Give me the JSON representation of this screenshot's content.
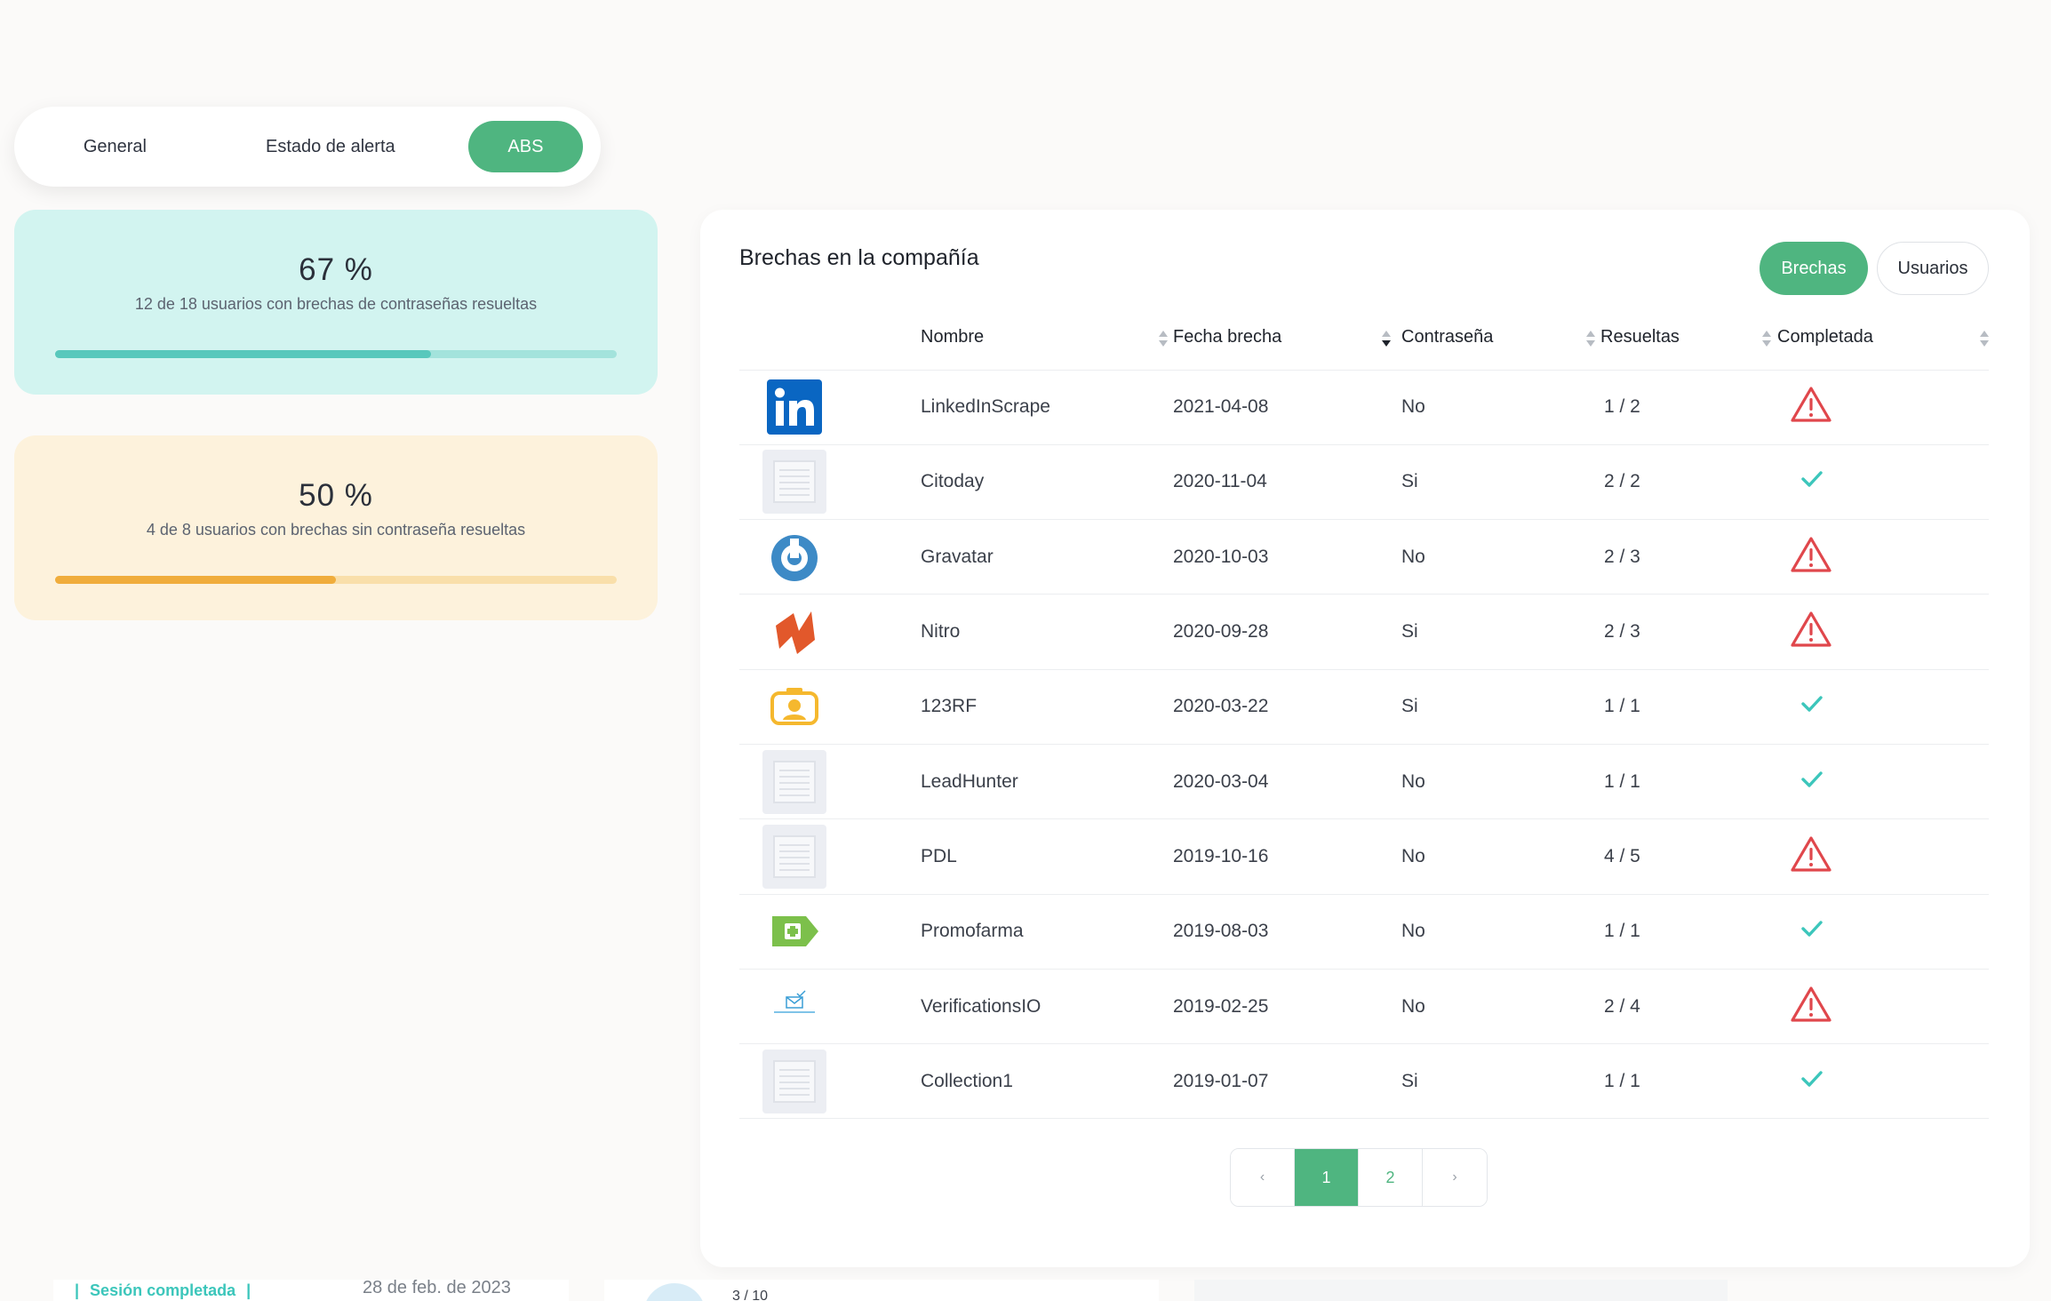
{
  "tabs": [
    {
      "label": "General",
      "active": false
    },
    {
      "label": "Estado de alerta",
      "active": false
    },
    {
      "label": "ABS",
      "active": true
    }
  ],
  "stats": [
    {
      "percent": "67 %",
      "description": "12 de 18 usuarios con brechas de contraseñas resueltas",
      "progress": 0.67,
      "color": "#58c8bc"
    },
    {
      "percent": "50 %",
      "description": "4 de 8 usuarios con brechas sin contraseña resueltas",
      "progress": 0.5,
      "color": "#f0ad3c"
    }
  ],
  "card": {
    "title": "Brechas en la compañía",
    "toggle": [
      {
        "label": "Brechas",
        "active": true
      },
      {
        "label": "Usuarios",
        "active": false
      }
    ]
  },
  "table": {
    "columns": [
      "Nombre",
      "Fecha brecha",
      "Contraseña",
      "Resueltas",
      "Completada"
    ],
    "rows": [
      {
        "logo": "linkedin-logo",
        "name": "LinkedInScrape",
        "date": "2021-04-08",
        "password": "No",
        "resolved": "1 / 2",
        "status": "warning"
      },
      {
        "logo": "placeholder",
        "name": "Citoday",
        "date": "2020-11-04",
        "password": "Si",
        "resolved": "2 / 2",
        "status": "check"
      },
      {
        "logo": "gravatar-logo",
        "name": "Gravatar",
        "date": "2020-10-03",
        "password": "No",
        "resolved": "2 / 3",
        "status": "warning"
      },
      {
        "logo": "nitro-logo",
        "name": "Nitro",
        "date": "2020-09-28",
        "password": "Si",
        "resolved": "2 / 3",
        "status": "warning"
      },
      {
        "logo": "123rf-logo",
        "name": "123RF",
        "date": "2020-03-22",
        "password": "Si",
        "resolved": "1 / 1",
        "status": "check"
      },
      {
        "logo": "placeholder",
        "name": "LeadHunter",
        "date": "2020-03-04",
        "password": "No",
        "resolved": "1 / 1",
        "status": "check"
      },
      {
        "logo": "placeholder",
        "name": "PDL",
        "date": "2019-10-16",
        "password": "No",
        "resolved": "4 / 5",
        "status": "warning"
      },
      {
        "logo": "promofarma-logo",
        "name": "Promofarma",
        "date": "2019-08-03",
        "password": "No",
        "resolved": "1 / 1",
        "status": "check"
      },
      {
        "logo": "verificationsio-logo",
        "name": "VerificationsIO",
        "date": "2019-02-25",
        "password": "No",
        "resolved": "2 / 4",
        "status": "warning"
      },
      {
        "logo": "placeholder",
        "name": "Collection1",
        "date": "2019-01-07",
        "password": "Si",
        "resolved": "1 / 1",
        "status": "check"
      }
    ]
  },
  "pagination": {
    "prev": "‹",
    "pages": [
      "1",
      "2"
    ],
    "current": "1",
    "next": "›"
  },
  "bottom": {
    "session": "Sesión completada",
    "date": "28 de feb. de 2023",
    "fraction": "3 / 10"
  },
  "colors": {
    "accent": "#4fb580",
    "warning": "#e0474c",
    "check": "#3cc6bb"
  }
}
